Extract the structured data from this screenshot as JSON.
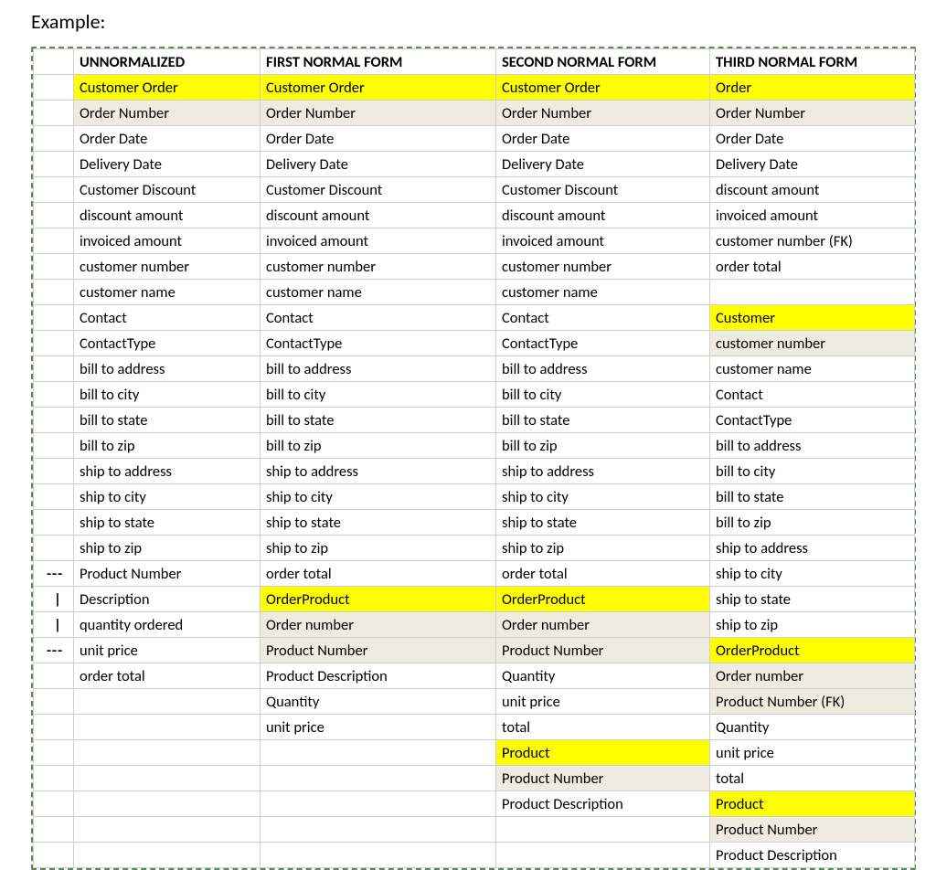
{
  "heading": "Example:",
  "headers": [
    "UNNORMALIZED",
    "FIRST NORMAL FORM",
    "SECOND NORMAL FORM",
    "THIRD NORMAL FORM"
  ],
  "rows": [
    {
      "marker": "",
      "cells": [
        [
          "Customer Order",
          "yellow"
        ],
        [
          "Customer Order",
          "yellow"
        ],
        [
          "Customer Order",
          "yellow"
        ],
        [
          "Order",
          "yellow"
        ]
      ]
    },
    {
      "marker": "",
      "cells": [
        [
          "Order Number",
          "grey"
        ],
        [
          "Order Number",
          "grey"
        ],
        [
          "Order Number",
          "grey"
        ],
        [
          "Order Number",
          "grey"
        ]
      ]
    },
    {
      "marker": "",
      "cells": [
        [
          "Order Date",
          ""
        ],
        [
          "Order Date",
          ""
        ],
        [
          "Order Date",
          ""
        ],
        [
          "Order Date",
          ""
        ]
      ]
    },
    {
      "marker": "",
      "cells": [
        [
          "Delivery Date",
          ""
        ],
        [
          "Delivery Date",
          ""
        ],
        [
          "Delivery Date",
          ""
        ],
        [
          "Delivery Date",
          ""
        ]
      ]
    },
    {
      "marker": "",
      "cells": [
        [
          "Customer Discount",
          ""
        ],
        [
          "Customer Discount",
          ""
        ],
        [
          "Customer Discount",
          ""
        ],
        [
          "discount amount",
          ""
        ]
      ]
    },
    {
      "marker": "",
      "cells": [
        [
          "discount amount",
          ""
        ],
        [
          "discount amount",
          ""
        ],
        [
          "discount amount",
          ""
        ],
        [
          "invoiced amount",
          ""
        ]
      ]
    },
    {
      "marker": "",
      "cells": [
        [
          "invoiced amount",
          ""
        ],
        [
          "invoiced amount",
          ""
        ],
        [
          "invoiced amount",
          ""
        ],
        [
          "customer number (FK)",
          ""
        ]
      ]
    },
    {
      "marker": "",
      "cells": [
        [
          "customer number",
          ""
        ],
        [
          "customer number",
          ""
        ],
        [
          "customer number",
          ""
        ],
        [
          "order total",
          ""
        ]
      ]
    },
    {
      "marker": "",
      "cells": [
        [
          "customer name",
          ""
        ],
        [
          "customer name",
          ""
        ],
        [
          "customer name",
          ""
        ],
        [
          "",
          ""
        ]
      ]
    },
    {
      "marker": "",
      "cells": [
        [
          "Contact",
          ""
        ],
        [
          "Contact",
          ""
        ],
        [
          "Contact",
          ""
        ],
        [
          "Customer",
          "yellow"
        ]
      ]
    },
    {
      "marker": "",
      "cells": [
        [
          "ContactType",
          ""
        ],
        [
          "ContactType",
          ""
        ],
        [
          "ContactType",
          ""
        ],
        [
          "customer number",
          "grey"
        ]
      ]
    },
    {
      "marker": "",
      "cells": [
        [
          "bill to address",
          ""
        ],
        [
          "bill to address",
          ""
        ],
        [
          "bill to address",
          ""
        ],
        [
          "customer name",
          ""
        ]
      ]
    },
    {
      "marker": "",
      "cells": [
        [
          "bill to city",
          ""
        ],
        [
          "bill to city",
          ""
        ],
        [
          "bill to city",
          ""
        ],
        [
          "Contact",
          ""
        ]
      ]
    },
    {
      "marker": "",
      "cells": [
        [
          "bill to state",
          ""
        ],
        [
          "bill to state",
          ""
        ],
        [
          "bill to state",
          ""
        ],
        [
          "ContactType",
          ""
        ]
      ]
    },
    {
      "marker": "",
      "cells": [
        [
          "bill to zip",
          ""
        ],
        [
          "bill to zip",
          ""
        ],
        [
          "bill to zip",
          ""
        ],
        [
          "bill to address",
          ""
        ]
      ]
    },
    {
      "marker": "",
      "cells": [
        [
          "ship to address",
          ""
        ],
        [
          "ship to address",
          ""
        ],
        [
          "ship to address",
          ""
        ],
        [
          "bill to city",
          ""
        ]
      ]
    },
    {
      "marker": "",
      "cells": [
        [
          "ship to city",
          ""
        ],
        [
          "ship to city",
          ""
        ],
        [
          "ship to city",
          ""
        ],
        [
          "bill to state",
          ""
        ]
      ]
    },
    {
      "marker": "",
      "cells": [
        [
          "ship to state",
          ""
        ],
        [
          "ship to state",
          ""
        ],
        [
          "ship to state",
          ""
        ],
        [
          "bill to zip",
          ""
        ]
      ]
    },
    {
      "marker": "",
      "cells": [
        [
          "ship to zip",
          ""
        ],
        [
          "ship to zip",
          ""
        ],
        [
          "ship to zip",
          ""
        ],
        [
          "ship to address",
          ""
        ]
      ]
    },
    {
      "marker": "---",
      "cells": [
        [
          "Product Number",
          ""
        ],
        [
          "order total",
          ""
        ],
        [
          "order total",
          ""
        ],
        [
          "ship to city",
          ""
        ]
      ]
    },
    {
      "marker": "|",
      "cells": [
        [
          "Description",
          ""
        ],
        [
          "OrderProduct",
          "yellow"
        ],
        [
          "OrderProduct",
          "yellow"
        ],
        [
          "ship to state",
          ""
        ]
      ]
    },
    {
      "marker": "|",
      "cells": [
        [
          "quantity ordered",
          ""
        ],
        [
          "Order number",
          "grey"
        ],
        [
          "Order number",
          "grey"
        ],
        [
          "ship to zip",
          ""
        ]
      ]
    },
    {
      "marker": "---",
      "cells": [
        [
          "unit price",
          ""
        ],
        [
          "Product Number",
          "grey"
        ],
        [
          "Product Number",
          "grey"
        ],
        [
          "OrderProduct",
          "yellow"
        ]
      ]
    },
    {
      "marker": "",
      "cells": [
        [
          "order total",
          ""
        ],
        [
          "Product Description",
          ""
        ],
        [
          "Quantity",
          ""
        ],
        [
          "Order number",
          "grey"
        ]
      ]
    },
    {
      "marker": "",
      "cells": [
        [
          "",
          ""
        ],
        [
          "Quantity",
          ""
        ],
        [
          "unit price",
          ""
        ],
        [
          "Product Number (FK)",
          "grey"
        ]
      ]
    },
    {
      "marker": "",
      "cells": [
        [
          "",
          ""
        ],
        [
          "unit price",
          ""
        ],
        [
          "total",
          ""
        ],
        [
          "Quantity",
          ""
        ]
      ]
    },
    {
      "marker": "",
      "cells": [
        [
          "",
          ""
        ],
        [
          "",
          ""
        ],
        [
          "Product",
          "yellow"
        ],
        [
          "unit price",
          ""
        ]
      ]
    },
    {
      "marker": "",
      "cells": [
        [
          "",
          ""
        ],
        [
          "",
          ""
        ],
        [
          "Product Number",
          "grey"
        ],
        [
          "total",
          ""
        ]
      ]
    },
    {
      "marker": "",
      "cells": [
        [
          "",
          ""
        ],
        [
          "",
          ""
        ],
        [
          "Product Description",
          ""
        ],
        [
          "Product",
          "yellow"
        ]
      ]
    },
    {
      "marker": "",
      "cells": [
        [
          "",
          ""
        ],
        [
          "",
          ""
        ],
        [
          "",
          ""
        ],
        [
          "Product Number",
          "grey"
        ]
      ]
    },
    {
      "marker": "",
      "cells": [
        [
          "",
          ""
        ],
        [
          "",
          ""
        ],
        [
          "",
          ""
        ],
        [
          "Product Description",
          ""
        ]
      ]
    }
  ]
}
